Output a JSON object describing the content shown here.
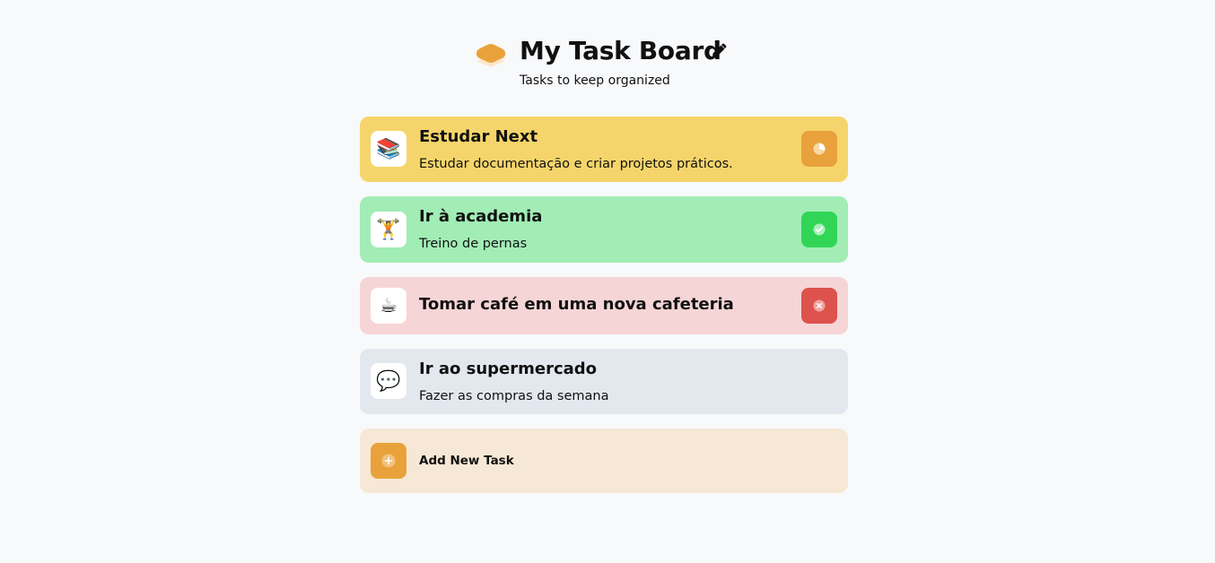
{
  "header": {
    "title": "My Task Board",
    "subtitle": "Tasks to keep organized",
    "logo_icon": "stack-layers-icon",
    "edit_icon": "pencil-icon"
  },
  "colors": {
    "background": "#f8f9fb",
    "in_progress": "#f5d56b",
    "in_progress_badge": "#e9a23b",
    "completed": "#a1edb5",
    "completed_badge": "#32d657",
    "wont_do": "#f6d5d6",
    "wont_do_badge": "#dd524c",
    "todo": "#e3e8ef",
    "add_card": "#f6e8d5",
    "add_badge": "#e9a23b"
  },
  "tasks": [
    {
      "icon": "📚",
      "title": "Estudar Next",
      "description": "Estudar documentação e criar projetos práticos.",
      "status_icon": "clock-icon"
    },
    {
      "icon": "🏋️",
      "title": "Ir à academia",
      "description": "Treino de pernas",
      "status_icon": "check-icon"
    },
    {
      "icon": "☕",
      "title": "Tomar café em uma nova cafeteria",
      "description": "",
      "status_icon": "close-icon"
    },
    {
      "icon": "💬",
      "title": "Ir ao supermercado",
      "description": "Fazer as compras da semana",
      "status_icon": ""
    }
  ],
  "add_task": {
    "label": "Add New Task",
    "icon": "plus-icon"
  }
}
